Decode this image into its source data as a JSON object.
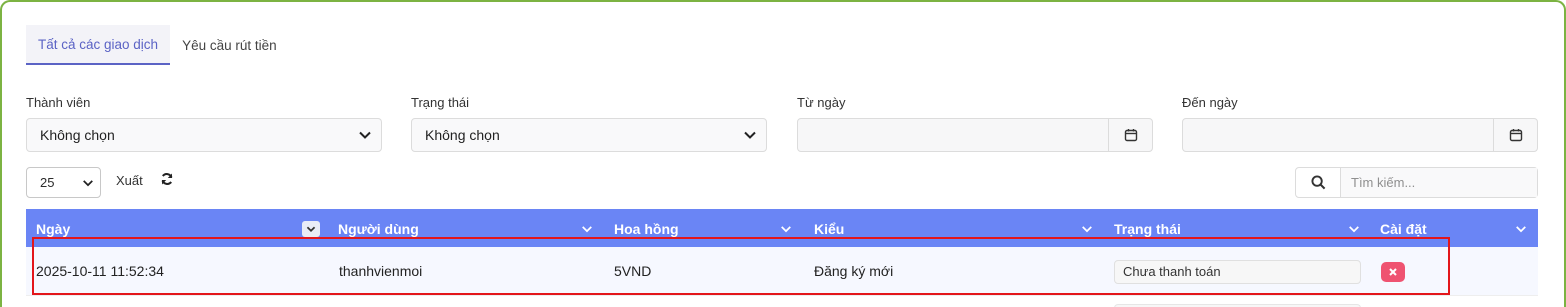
{
  "tabs": [
    {
      "label": "Tất cả các giao dịch",
      "active": true
    },
    {
      "label": "Yêu cầu rút tiền",
      "active": false
    }
  ],
  "filters": {
    "member": {
      "label": "Thành viên",
      "value": "Không chọn"
    },
    "status": {
      "label": "Trạng thái",
      "value": "Không chọn"
    },
    "from_date": {
      "label": "Từ ngày",
      "value": ""
    },
    "to_date": {
      "label": "Đến ngày",
      "value": ""
    }
  },
  "toolbar": {
    "page_size": "25",
    "export_label": "Xuất",
    "search_placeholder": "Tìm kiếm..."
  },
  "table": {
    "columns": [
      "Ngày",
      "Người dùng",
      "Hoa hồng",
      "Kiểu",
      "Trạng thái",
      "Cài đặt"
    ],
    "rows": [
      {
        "date": "2025-10-11 11:52:34",
        "user": "thanhvienmoi",
        "commission": "5VND",
        "type": "Đăng ký mới",
        "status": "Chưa thanh toán"
      }
    ]
  },
  "colors": {
    "header_bg": "#6a85f5",
    "active_tab": "#5b63c5",
    "delete_button": "#ef5371",
    "highlight_border": "#e3161b",
    "frame_border": "#7cb342"
  }
}
